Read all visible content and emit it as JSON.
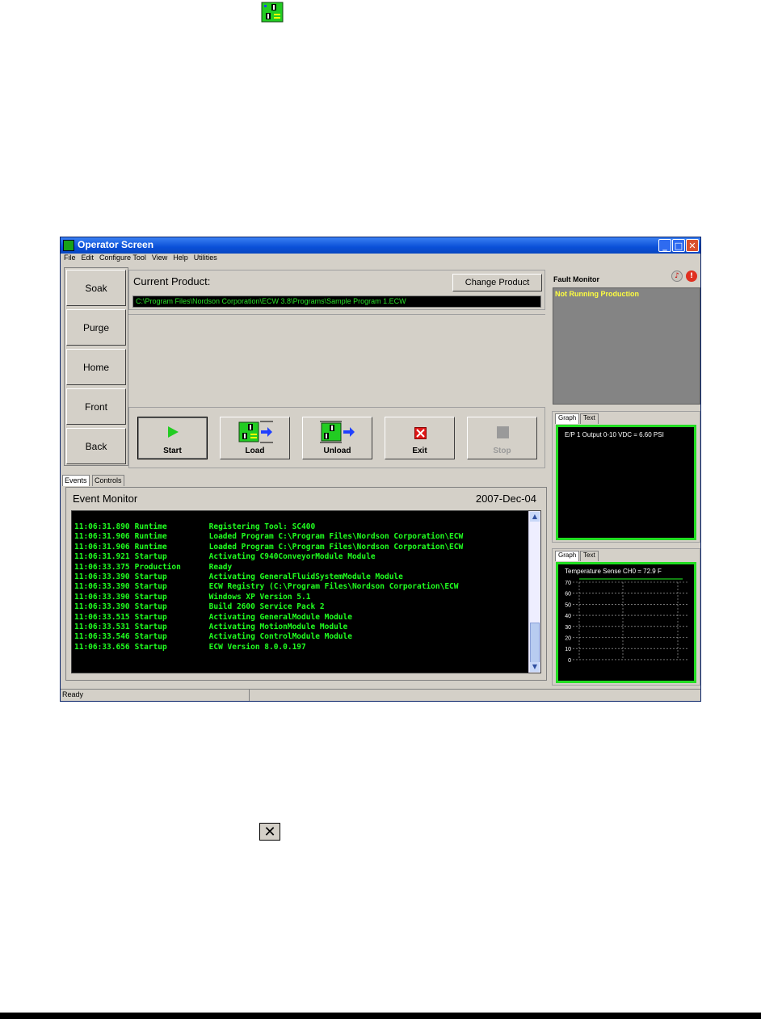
{
  "window": {
    "title": "Operator Screen",
    "controls": {
      "minimize": "_",
      "maximize": "□",
      "close": "✕"
    }
  },
  "menu": [
    "File",
    "Edit",
    "Configure Tool",
    "View",
    "Help",
    "Utilities"
  ],
  "sidebar": {
    "items": [
      {
        "label": "Soak"
      },
      {
        "label": "Purge"
      },
      {
        "label": "Home"
      },
      {
        "label": "Front"
      },
      {
        "label": "Back"
      }
    ]
  },
  "product": {
    "label": "Current Product:",
    "change_button": "Change Product",
    "path": "C:\\Program Files\\Nordson Corporation\\ECW 3.8\\Programs\\Sample Program 1.ECW"
  },
  "actions": [
    {
      "label": "Start",
      "icon": "play-icon"
    },
    {
      "label": "Load",
      "icon": "load-module-icon"
    },
    {
      "label": "Unload",
      "icon": "unload-module-icon"
    },
    {
      "label": "Exit",
      "icon": "exit-icon"
    },
    {
      "label": "Stop",
      "icon": "stop-icon"
    }
  ],
  "tabs": {
    "events": "Events",
    "controls": "Controls"
  },
  "event_monitor": {
    "title": "Event Monitor",
    "date": "2007-Dec-04",
    "lines": [
      {
        "time": "11:06:31.890",
        "source": "Runtime",
        "message": "Registering Tool: SC400"
      },
      {
        "time": "11:06:31.906",
        "source": "Runtime",
        "message": "Loaded Program C:\\Program Files\\Nordson Corporation\\ECW"
      },
      {
        "time": "11:06:31.906",
        "source": "Runtime",
        "message": "Loaded Program C:\\Program Files\\Nordson Corporation\\ECW"
      },
      {
        "time": "11:06:31.921",
        "source": "Startup",
        "message": "Activating C940ConveyorModule Module"
      },
      {
        "time": "11:06:33.375",
        "source": "Production",
        "message": "Ready"
      },
      {
        "time": "11:06:33.390",
        "source": "Startup",
        "message": "Activating GeneralFluidSystemModule Module"
      },
      {
        "time": "11:06:33.390",
        "source": "Startup",
        "message": "ECW Registry (C:\\Program Files\\Nordson Corporation\\ECW"
      },
      {
        "time": "11:06:33.390",
        "source": "Startup",
        "message": "Windows XP Version 5.1"
      },
      {
        "time": "11:06:33.390",
        "source": "Startup",
        "message": "Build 2600 Service Pack 2"
      },
      {
        "time": "11:06:33.515",
        "source": "Startup",
        "message": "Activating GeneralModule Module"
      },
      {
        "time": "11:06:33.531",
        "source": "Startup",
        "message": "Activating MotionModule Module"
      },
      {
        "time": "11:06:33.546",
        "source": "Startup",
        "message": "Activating ControlModule Module"
      },
      {
        "time": "11:06:33.656",
        "source": "Startup",
        "message": "ECW Version 8.0.0.197"
      }
    ]
  },
  "fault_monitor": {
    "title": "Fault Monitor",
    "status": "Not Running Production",
    "icons": [
      "speaker-icon",
      "alarm-icon"
    ]
  },
  "graph1": {
    "tab_graph": "Graph",
    "tab_text": "Text",
    "label": "E/P 1 Output 0-10 VDC = 6.60 PSI"
  },
  "graph2": {
    "tab_graph": "Graph",
    "tab_text": "Text",
    "label": "Temperature Sense CH0 = 72.9 F",
    "y_ticks": [
      "70",
      "60",
      "50",
      "40",
      "30",
      "20",
      "10",
      "0"
    ],
    "value": 72.9
  },
  "status": "Ready",
  "colors": {
    "log_text": "#20ff20",
    "graph_border": "#22dd22",
    "fault_text": "#ffff40"
  }
}
